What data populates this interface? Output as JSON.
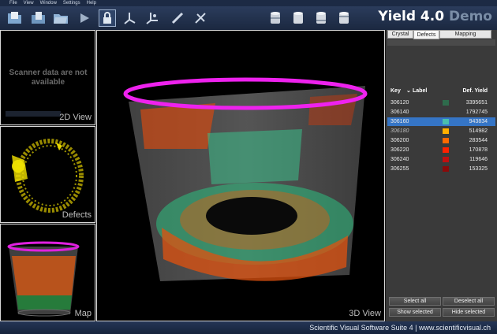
{
  "menu": [
    "File",
    "View",
    "Window",
    "Settings",
    "Help"
  ],
  "toolbar": {
    "icons": [
      "open-folder-icon",
      "open-file-icon",
      "folder-icon",
      "play-icon",
      "lock-icon",
      "axes-icon",
      "axes-alt-icon",
      "ruler-icon",
      "measure-icon",
      "cylinder-1-icon",
      "cylinder-2-icon",
      "cylinder-3-icon",
      "cylinder-4-icon"
    ]
  },
  "app_title": {
    "main": "Yield 4.0",
    "suffix": "Demo"
  },
  "views": {
    "view2d": {
      "label": "2D View",
      "message": "Scanner data are not available"
    },
    "defects": {
      "label": "Defects"
    },
    "map": {
      "label": "Map"
    },
    "view3d": {
      "label": "3D View"
    }
  },
  "tabs": [
    {
      "label": "Crystal",
      "active": false
    },
    {
      "label": "Defects",
      "active": true
    },
    {
      "label": "Mapping",
      "active": false
    }
  ],
  "table": {
    "headers": {
      "key": "Key",
      "label": "Label",
      "yield": "Def. Yield"
    },
    "rows": [
      {
        "key": "306120",
        "color": "#2e6b4c",
        "yield": "3395651",
        "selected": false,
        "italic": false
      },
      {
        "key": "306140",
        "color": "#3a3a3a",
        "yield": "1792745",
        "selected": false,
        "italic": false
      },
      {
        "key": "306160",
        "color": "#49bfae",
        "yield": "943834",
        "selected": true,
        "italic": false
      },
      {
        "key": "306180",
        "color": "#ffb000",
        "yield": "514982",
        "selected": false,
        "italic": true
      },
      {
        "key": "306200",
        "color": "#ff6a00",
        "yield": "283544",
        "selected": false,
        "italic": false
      },
      {
        "key": "306220",
        "color": "#ff2200",
        "yield": "170878",
        "selected": false,
        "italic": false
      },
      {
        "key": "306240",
        "color": "#c01010",
        "yield": "119646",
        "selected": false,
        "italic": false
      },
      {
        "key": "306255",
        "color": "#8a0a0a",
        "yield": "153325",
        "selected": false,
        "italic": false
      }
    ]
  },
  "buttons": {
    "select_all": "Select all",
    "deselect_all": "Deselect all",
    "show_selected": "Show selected",
    "hide_selected": "Hide selected"
  },
  "status": "Scientific Visual Software Suite 4 | www.scientificvisual.ch"
}
